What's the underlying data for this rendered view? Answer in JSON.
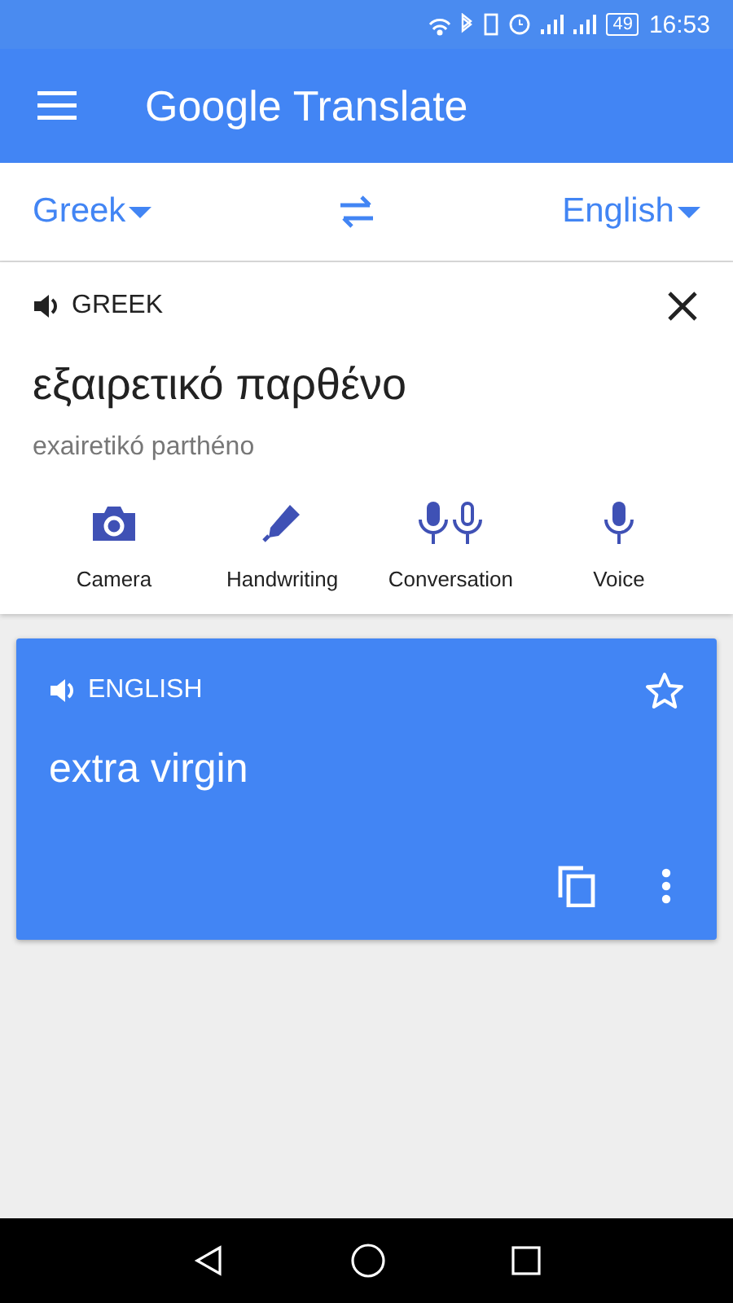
{
  "status_bar": {
    "battery": "49",
    "time": "16:53"
  },
  "app_bar": {
    "title_logo": "Google",
    "title": "Translate"
  },
  "languages": {
    "source": "Greek",
    "target": "English"
  },
  "input": {
    "language_label": "GREEK",
    "text": "εξαιρετικό παρθένο",
    "transliteration": "exairetikó parthéno",
    "tools": [
      {
        "kind": "camera",
        "label": "Camera"
      },
      {
        "kind": "handwriting",
        "label": "Handwriting"
      },
      {
        "kind": "conversation",
        "label": "Conversation"
      },
      {
        "kind": "voice",
        "label": "Voice"
      }
    ]
  },
  "output": {
    "language_label": "ENGLISH",
    "text": "extra virgin",
    "starred": false
  }
}
